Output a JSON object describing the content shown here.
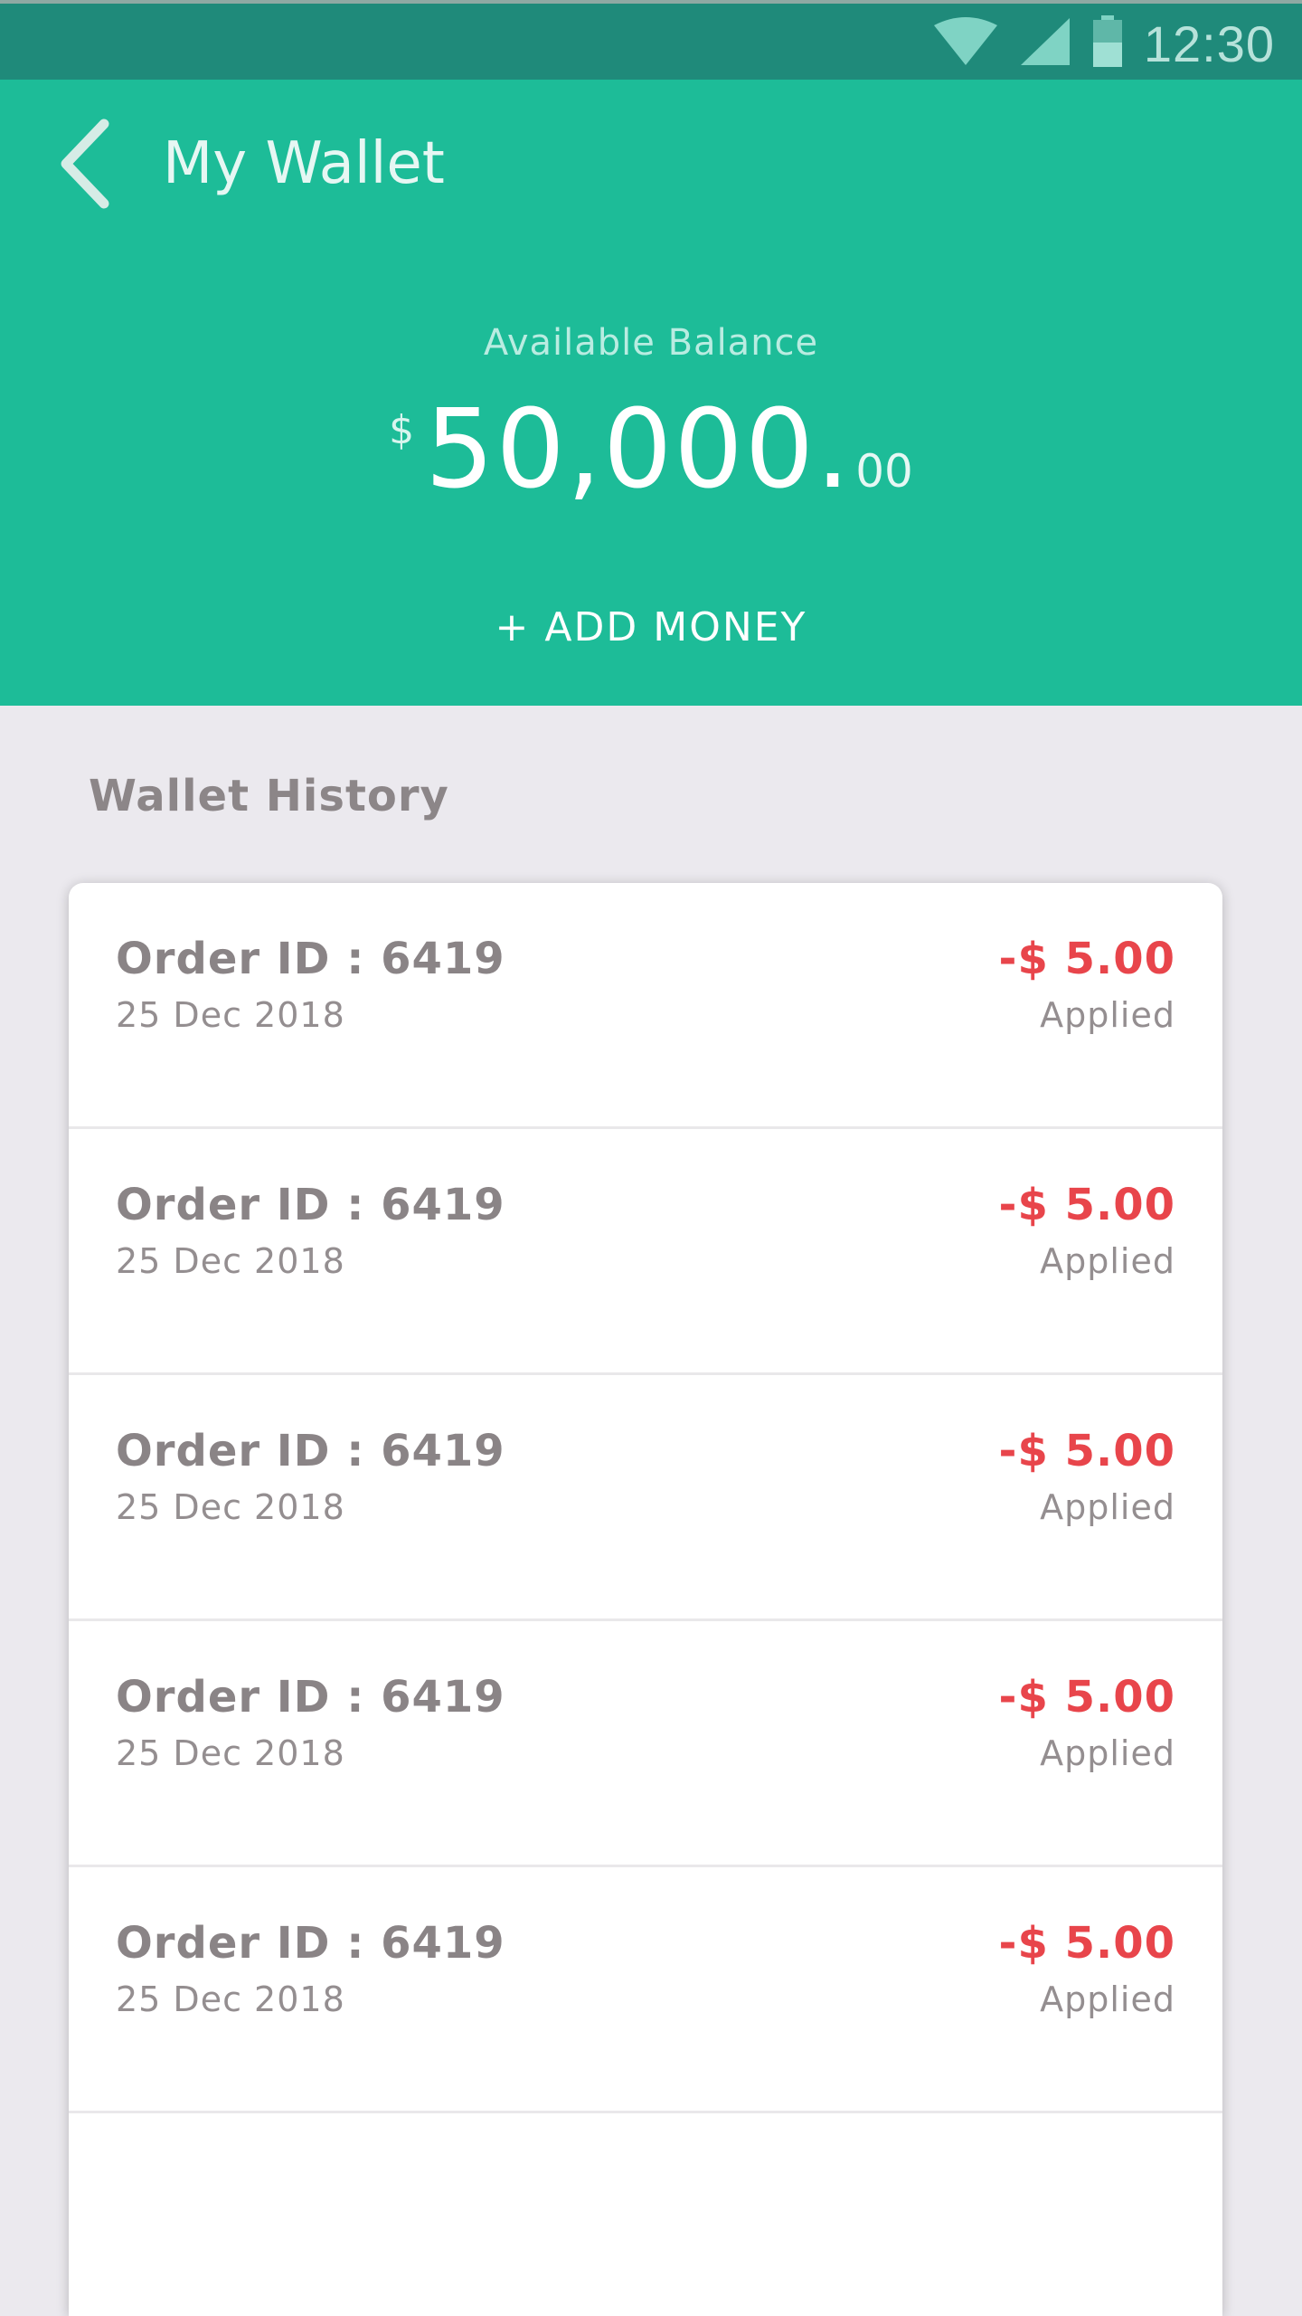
{
  "status_bar": {
    "time": "12:30",
    "icons": [
      "wifi-icon",
      "signal-icon",
      "battery-icon"
    ]
  },
  "header": {
    "title": "My Wallet",
    "back_icon": "chevron-left-icon",
    "balance_label": "Available Balance",
    "balance_currency": "$",
    "balance_whole": "50,000.",
    "balance_cents": "00",
    "add_money_label": "+ ADD MONEY"
  },
  "history": {
    "title": "Wallet History",
    "items": [
      {
        "order": "Order ID : 6419",
        "date": "25 Dec 2018",
        "amount": "-$ 5.00",
        "status": "Applied"
      },
      {
        "order": "Order ID : 6419",
        "date": "25 Dec 2018",
        "amount": "-$ 5.00",
        "status": "Applied"
      },
      {
        "order": "Order ID : 6419",
        "date": "25 Dec 2018",
        "amount": "-$ 5.00",
        "status": "Applied"
      },
      {
        "order": "Order ID : 6419",
        "date": "25 Dec 2018",
        "amount": "-$ 5.00",
        "status": "Applied"
      },
      {
        "order": "Order ID : 6419",
        "date": "25 Dec 2018",
        "amount": "-$ 5.00",
        "status": "Applied"
      }
    ]
  },
  "colors": {
    "status_bar": "#1f8a7a",
    "header": "#1dbc98",
    "background": "#ebe9ee",
    "negative_amount": "#e8454b"
  }
}
